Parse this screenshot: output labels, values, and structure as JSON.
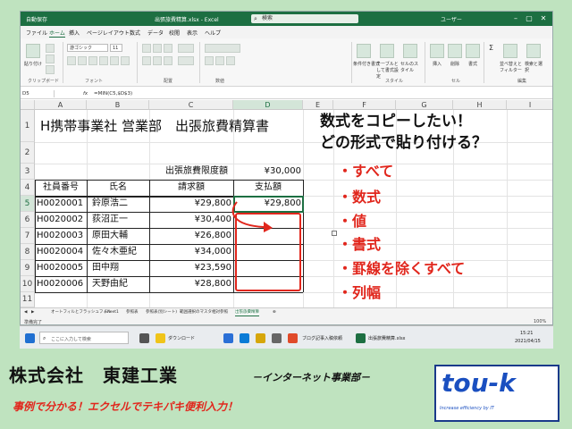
{
  "window": {
    "title": "出張旅費精算.xlsx - Excel",
    "autosave": "自動保存",
    "search_placeholder": "検索",
    "user": "ユーザー"
  },
  "ribbon": {
    "tabs": [
      "ファイル",
      "ホーム",
      "挿入",
      "ページレイアウト",
      "数式",
      "データ",
      "校閲",
      "表示",
      "ヘルプ"
    ],
    "active_tab": "ホーム",
    "font_name": "游ゴシック",
    "font_size": "11",
    "groups": {
      "clipboard": "クリップボード",
      "font": "フォント",
      "alignment": "配置",
      "number": "数値",
      "styles": "スタイル",
      "cells": "セル",
      "editing": "編集"
    },
    "buttons": {
      "paste": "貼り付け",
      "conditional": "条件付き書式",
      "table": "テーブルとして書式設定",
      "cell_style": "セルのスタイル",
      "insert": "挿入",
      "delete": "削除",
      "format": "書式",
      "sum": "Σ",
      "sort": "並べ替えとフィルター",
      "find": "検索と選択"
    }
  },
  "formula_bar": {
    "name_box": "D5",
    "fx": "fx",
    "formula": "=MIN(C5,$D$3)"
  },
  "columns": [
    "A",
    "B",
    "C",
    "D",
    "E",
    "F",
    "G",
    "H",
    "I"
  ],
  "rows": [
    "1",
    "2",
    "3",
    "4",
    "5",
    "6",
    "7",
    "8",
    "9",
    "10",
    "11",
    "12",
    "13"
  ],
  "sheet": {
    "title": "H携帯事業社 営業部　出張旅費精算書",
    "limit_label": "出張旅費限度額",
    "limit_value": "¥30,000",
    "headers": [
      "社員番号",
      "氏名",
      "請求額",
      "支払額"
    ],
    "records": [
      {
        "id": "H0020001",
        "name": "鈴原浩二",
        "claim": "¥29,800",
        "paid": "¥29,800"
      },
      {
        "id": "H0020002",
        "name": "荻沼正一",
        "claim": "¥30,400",
        "paid": ""
      },
      {
        "id": "H0020003",
        "name": "原田大輔",
        "claim": "¥26,800",
        "paid": ""
      },
      {
        "id": "H0020004",
        "name": "佐々木亜紀",
        "claim": "¥34,000",
        "paid": ""
      },
      {
        "id": "H0020005",
        "name": "田中翔",
        "claim": "¥23,590",
        "paid": ""
      },
      {
        "id": "H0020006",
        "name": "天野由紀",
        "claim": "¥28,800",
        "paid": ""
      }
    ]
  },
  "overlay": {
    "line1": "数式をコピーしたい！",
    "line2": "どの形式で貼り付ける？",
    "options": [
      "・すべて",
      "・数式",
      "・値",
      "・書式",
      "・罫線を除くすべて",
      "・列幅"
    ]
  },
  "sheet_tabs": [
    "オートフィルとフラッシュフィル",
    "Sheet1",
    "参照表",
    "参照表(別シート)",
    "範囲選択のマスタ",
    "相対参照",
    "出張旅費精算"
  ],
  "active_sheet": "出張旅費精算",
  "status": {
    "ready": "準備完了",
    "zoom": "100%"
  },
  "taskbar": {
    "search": "ここに入力して検索",
    "items": [
      "ダウンロード",
      "ブログ記事入稿依頼",
      "出張旅費精算.xlsx"
    ],
    "time": "15:21",
    "date": "2021/04/15"
  },
  "banner": {
    "company": "株式会社　東建工業",
    "dept": "－インターネット事業部－",
    "tagline": "事例で分かる！エクセルでテキパキ便利入力！",
    "logo": "tou-k",
    "logo_sub": "Increase efficiency by IT"
  },
  "colors": {
    "excel_green": "#1d6f42",
    "accent_red": "#e1261c",
    "background": "#bfe3bf",
    "logo_blue": "#1a4fc0"
  }
}
